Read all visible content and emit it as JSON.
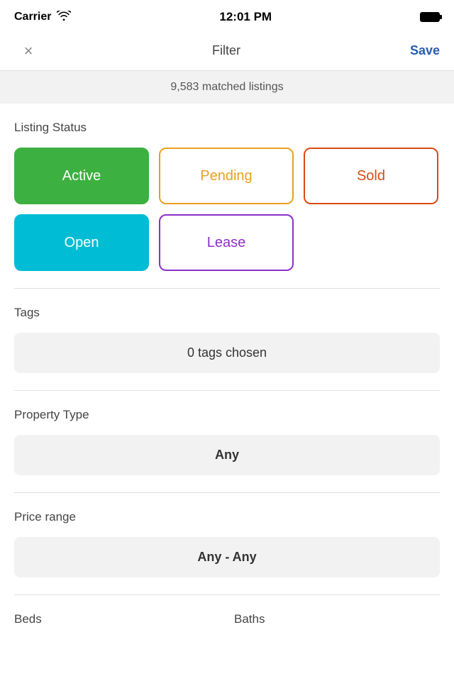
{
  "statusBar": {
    "carrier": "Carrier",
    "time": "12:01 PM"
  },
  "navBar": {
    "close": "×",
    "title": "Filter",
    "save": "Save"
  },
  "matched": {
    "text": "9,583 matched listings"
  },
  "listingStatus": {
    "label": "Listing Status",
    "buttons": [
      {
        "id": "active",
        "label": "Active",
        "state": "active-selected"
      },
      {
        "id": "pending",
        "label": "Pending",
        "state": "pending-unselected"
      },
      {
        "id": "sold",
        "label": "Sold",
        "state": "sold-unselected"
      },
      {
        "id": "open",
        "label": "Open",
        "state": "open-selected"
      },
      {
        "id": "lease",
        "label": "Lease",
        "state": "lease-unselected"
      }
    ]
  },
  "tags": {
    "label": "Tags",
    "buttonText": "0 tags chosen"
  },
  "propertyType": {
    "label": "Property Type",
    "buttonText": "Any"
  },
  "priceRange": {
    "label": "Price range",
    "buttonText": "Any - Any"
  },
  "bedsLabel": "Beds",
  "bathsLabel": "Baths"
}
